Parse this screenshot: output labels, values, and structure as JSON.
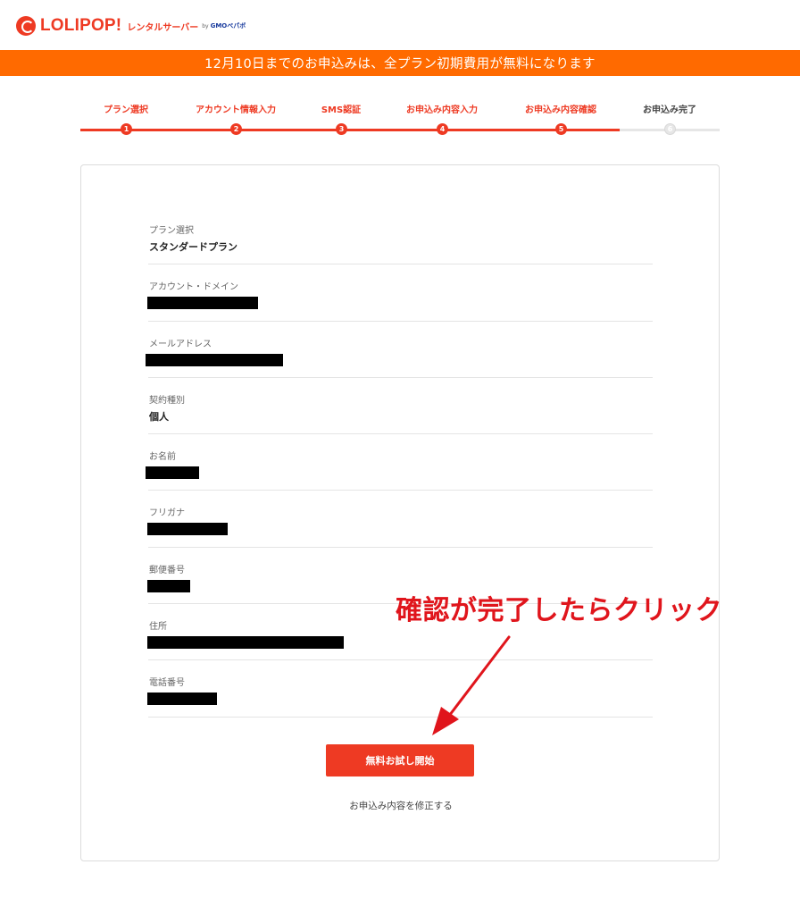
{
  "header": {
    "logo_text": "LOLIPOP!",
    "logo_sub": "レンタルサーバー",
    "logo_by": "by",
    "logo_gmo": "GMOペパボ"
  },
  "banner": {
    "text": "12月10日までのお申込みは、全プラン初期費用が無料になります"
  },
  "steps": [
    {
      "label": "プラン選択",
      "number": "1",
      "state": "done"
    },
    {
      "label": "アカウント情報入力",
      "number": "2",
      "state": "done"
    },
    {
      "label": "SMS認証",
      "number": "3",
      "state": "done"
    },
    {
      "label": "お申込み内容入力",
      "number": "4",
      "state": "done"
    },
    {
      "label": "お申込み内容確認",
      "number": "5",
      "state": "current"
    },
    {
      "label": "お申込み完了",
      "number": "6",
      "state": "upcoming"
    }
  ],
  "summary": [
    {
      "label": "プラン選択",
      "value": "スタンダードプラン"
    },
    {
      "label": "アカウント・ドメイン",
      "value": ""
    },
    {
      "label": "メールアドレス",
      "value": ""
    },
    {
      "label": "契約種別",
      "value": "個人"
    },
    {
      "label": "お名前",
      "value": ""
    },
    {
      "label": "フリガナ",
      "value": ""
    },
    {
      "label": "郵便番号",
      "value": ""
    },
    {
      "label": "住所",
      "value": ""
    },
    {
      "label": "電話番号",
      "value": ""
    }
  ],
  "actions": {
    "submit_label": "無料お試し開始",
    "edit_label": "お申込み内容を修正する"
  },
  "annotation": {
    "text": "確認が完了したらクリック"
  },
  "colors": {
    "brand": "#ee3a23",
    "banner": "#ff6a00",
    "annotation": "#e0151c"
  }
}
